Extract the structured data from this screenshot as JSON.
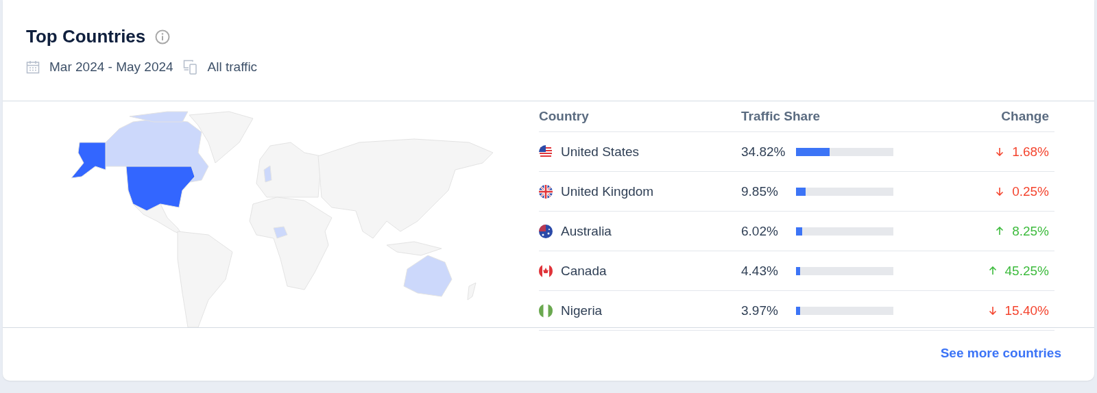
{
  "card": {
    "title": "Top Countries",
    "date_range": "Mar 2024 - May 2024",
    "traffic_type": "All traffic"
  },
  "table": {
    "columns": [
      "Country",
      "Traffic Share",
      "Change"
    ],
    "rows": [
      {
        "kind": "us",
        "country": "United States",
        "share": "34.82%",
        "level": 0.3482,
        "rising": false,
        "change": "1.68%"
      },
      {
        "kind": "uk",
        "country": "United Kingdom",
        "share": "9.85%",
        "level": 0.0985,
        "rising": false,
        "change": "0.25%"
      },
      {
        "kind": "au",
        "country": "Australia",
        "share": "6.02%",
        "level": 0.0602,
        "rising": true,
        "change": "8.25%"
      },
      {
        "kind": "ca",
        "country": "Canada",
        "share": "4.43%",
        "level": 0.0443,
        "rising": true,
        "change": "45.25%"
      },
      {
        "kind": "ng",
        "country": "Nigeria",
        "share": "3.97%",
        "level": 0.0397,
        "rising": false,
        "change": "15.40%"
      }
    ]
  },
  "footer": {
    "link": "See more countries"
  }
}
